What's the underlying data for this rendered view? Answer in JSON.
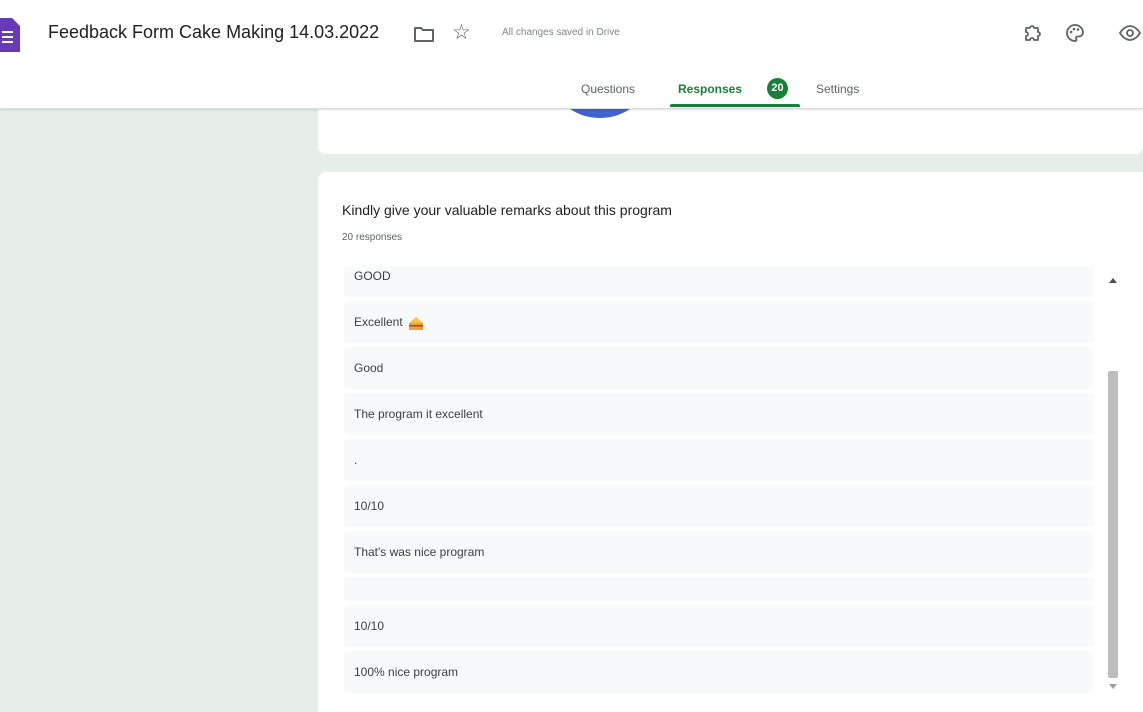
{
  "header": {
    "title": "Feedback Form Cake Making 14.03.2022",
    "save_status": "All changes saved in Drive",
    "icons": [
      "forms-logo-icon",
      "folder-icon",
      "star-icon",
      "addon-icon",
      "palette-icon",
      "preview-icon"
    ]
  },
  "tabs": {
    "questions": "Questions",
    "responses": "Responses",
    "responses_count": "20",
    "settings": "Settings",
    "active": "Responses"
  },
  "question": {
    "title": "Kindly give your valuable remarks about this program",
    "count": "20 responses",
    "responses": [
      "GOOD",
      "Excellent",
      "Good",
      "The program it excellent",
      ".",
      "10/10",
      "That's was nice program",
      "",
      "10/10",
      "100% nice program"
    ]
  },
  "colors": {
    "accent": "#188038",
    "background": "#e6efe7",
    "forms_purple": "#673ab7",
    "pie_blue": "#4162d0",
    "response_bg": "#f8f9fa"
  }
}
